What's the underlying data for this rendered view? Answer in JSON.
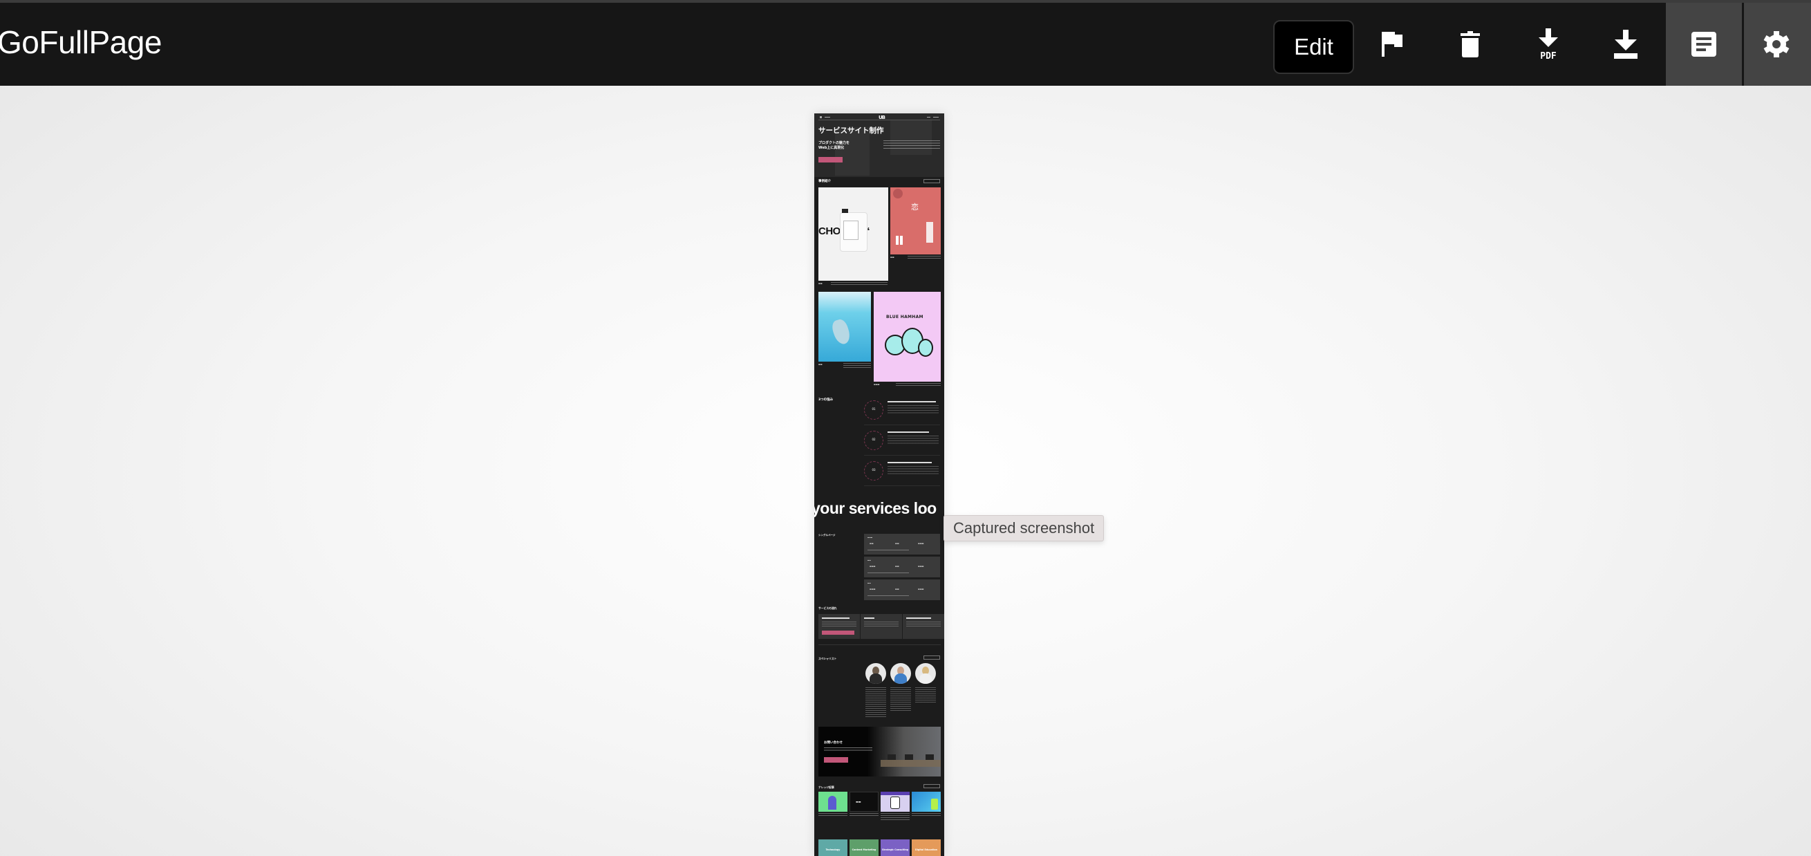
{
  "app": {
    "title": "GoFullPage"
  },
  "toolbar": {
    "edit_label": "Edit",
    "buttons": [
      {
        "name": "flag",
        "icon": "flag-icon"
      },
      {
        "name": "delete",
        "icon": "trash-icon"
      },
      {
        "name": "download-pdf",
        "icon": "download-pdf-icon",
        "badge": "PDF"
      },
      {
        "name": "download-image",
        "icon": "download-icon"
      },
      {
        "name": "page-list",
        "icon": "document-list-icon"
      },
      {
        "name": "settings",
        "icon": "gear-icon"
      }
    ]
  },
  "tooltip": {
    "text": "Captured screenshot"
  },
  "capture": {
    "nav_logo": "UB",
    "hero": {
      "title": "サービスサイト制作",
      "subtitle": "プロダクトの魅力を\nWeb上に具現化"
    },
    "cases": {
      "label": "事例紹介",
      "items": [
        {
          "thumb_text": "CHOC    T'S“"
        },
        {
          "thumb_text": "恋"
        },
        {
          "thumb_text": ""
        },
        {
          "thumb_text": "BLUE HAMHAM"
        }
      ]
    },
    "strengths": {
      "label": "3つの強み",
      "items": [
        {
          "num": "01"
        },
        {
          "num": "02"
        },
        {
          "num": "03"
        }
      ]
    },
    "slogan": "your services loo",
    "plans": {
      "label": "シングルページ"
    },
    "flow": {
      "label": "サービスの流れ"
    },
    "specialists": {
      "label": "スペシャリスト"
    },
    "contact": {
      "title": "お問い合わせ"
    },
    "articles": {
      "label": "ナレッジ記事"
    },
    "categories": [
      {
        "label": "Technology",
        "color": "#5fa9a6"
      },
      {
        "label": "Content Marketing",
        "color": "#5e9f6a"
      },
      {
        "label": "Strategic Consulting",
        "color": "#7b61c4"
      },
      {
        "label": "Digital Education",
        "color": "#e49a5a"
      }
    ]
  },
  "colors": {
    "header_bg": "#161616",
    "header_active_bg": "#444444",
    "accent_pink": "#c25779"
  }
}
